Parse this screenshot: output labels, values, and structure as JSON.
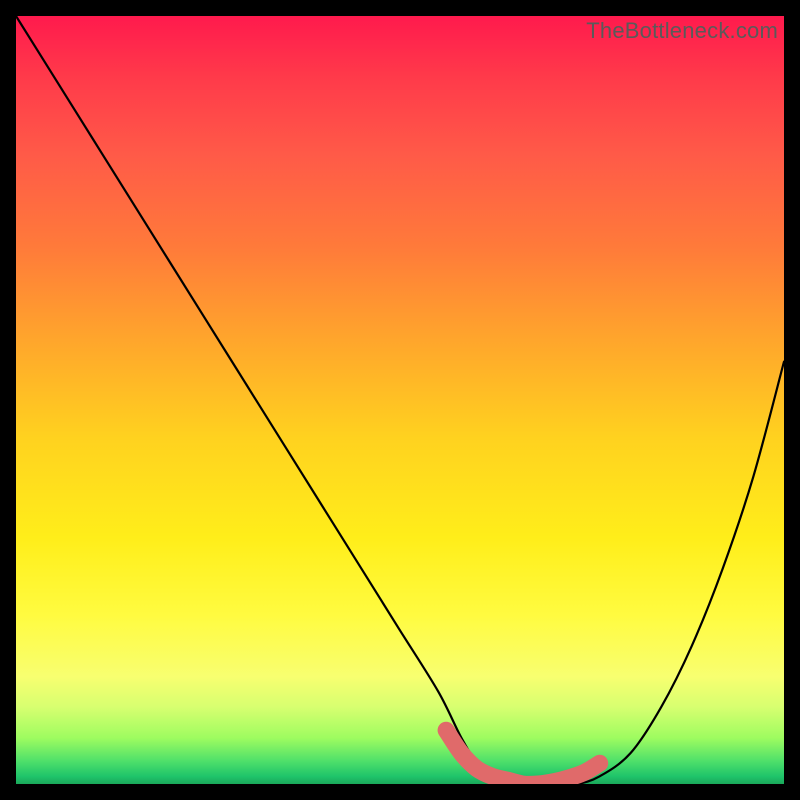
{
  "watermark": "TheBottleneck.com",
  "chart_data": {
    "type": "line",
    "title": "",
    "xlabel": "",
    "ylabel": "",
    "xlim": [
      0,
      100
    ],
    "ylim": [
      0,
      100
    ],
    "series": [
      {
        "name": "curve",
        "x": [
          0,
          5,
          10,
          15,
          20,
          25,
          30,
          35,
          40,
          45,
          50,
          55,
          58,
          60,
          63,
          66,
          70,
          73,
          76,
          80,
          84,
          88,
          92,
          96,
          100
        ],
        "y": [
          100,
          92,
          84,
          76,
          68,
          60,
          52,
          44,
          36,
          28,
          20,
          12,
          6,
          3,
          1,
          0,
          0,
          0,
          1,
          4,
          10,
          18,
          28,
          40,
          55
        ]
      }
    ],
    "marker_band": {
      "name": "highlight-band",
      "color": "#e06a6a",
      "x": [
        56,
        58,
        60,
        62,
        64,
        66,
        68,
        70,
        72,
        74,
        76
      ],
      "y": [
        7,
        4,
        2,
        1,
        0.5,
        0,
        0,
        0.3,
        0.8,
        1.5,
        2.7
      ]
    }
  }
}
